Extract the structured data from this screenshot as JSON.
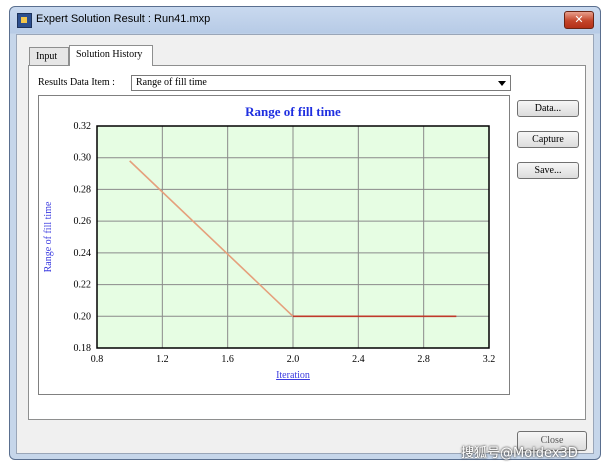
{
  "window": {
    "title": "Expert Solution Result : Run41.mxp",
    "close_glyph": "✕"
  },
  "tabs": [
    {
      "label": "Input"
    },
    {
      "label": "Solution History"
    }
  ],
  "results": {
    "label": "Results Data Item :",
    "selected": "Range of fill time"
  },
  "buttons": {
    "data": "Data...",
    "capture": "Capture",
    "save": "Save...",
    "close": "Close"
  },
  "chart_data": {
    "type": "line",
    "title": "Range of fill time",
    "xlabel": "Iteration",
    "ylabel": "Range of fill time",
    "xlim": [
      0.8,
      3.2
    ],
    "ylim": [
      0.18,
      0.32
    ],
    "xticks": [
      "0.8",
      "1.2",
      "1.6",
      "2.0",
      "2.4",
      "2.8",
      "3.2"
    ],
    "yticks": [
      "0.18",
      "0.20",
      "0.22",
      "0.24",
      "0.26",
      "0.28",
      "0.30",
      "0.32"
    ],
    "grid": true,
    "series": [
      {
        "x": [
          1.0,
          2.0
        ],
        "y": [
          0.298,
          0.2
        ],
        "color": "#e5a07c"
      },
      {
        "x": [
          2.0,
          3.0
        ],
        "y": [
          0.2,
          0.2
        ],
        "color": "#c0392b"
      }
    ],
    "plot_background": "#e6fde3",
    "title_color": "#1f2fe0",
    "label_color": "#3a3ae0"
  },
  "watermark": "搜狐号@Moldex3D"
}
